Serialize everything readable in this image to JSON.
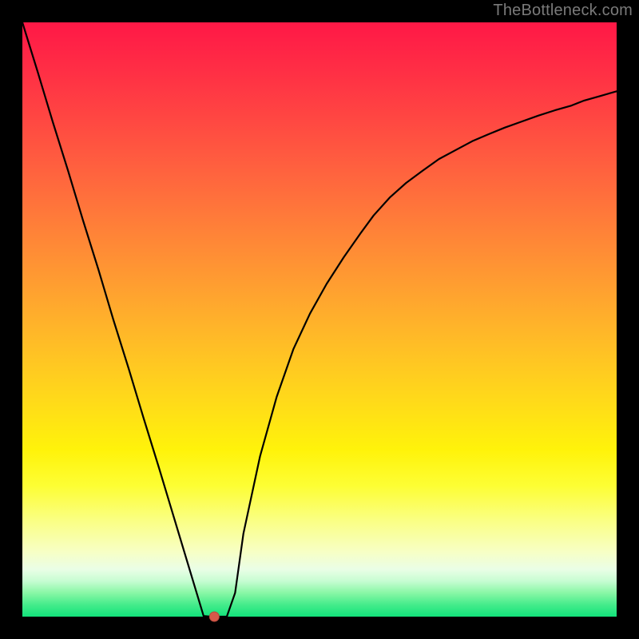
{
  "watermark": "TheBottleneck.com",
  "chart_data": {
    "type": "line",
    "title": "",
    "xlabel": "",
    "ylabel": "",
    "xlim": [
      0,
      100
    ],
    "ylim": [
      0,
      100
    ],
    "gradient_axis": "y",
    "gradient_stops": [
      {
        "pos": 0.0,
        "color": "#ff1846"
      },
      {
        "pos": 0.2,
        "color": "#ff5f3f"
      },
      {
        "pos": 0.45,
        "color": "#ffaa2d"
      },
      {
        "pos": 0.7,
        "color": "#fff30a"
      },
      {
        "pos": 0.86,
        "color": "#f9ffb0"
      },
      {
        "pos": 0.95,
        "color": "#8ff8aa"
      },
      {
        "pos": 1.0,
        "color": "#12e37b"
      }
    ],
    "series": [
      {
        "name": "curve",
        "x": [
          0.0,
          2.6,
          5.1,
          7.7,
          10.2,
          12.8,
          15.3,
          17.9,
          20.4,
          23.0,
          25.5,
          28.0,
          30.5,
          31.7,
          33.0,
          34.4,
          35.8,
          37.2,
          40.0,
          42.8,
          45.6,
          48.4,
          51.2,
          54.1,
          56.9,
          59.1,
          61.8,
          64.6,
          67.3,
          70.1,
          72.9,
          75.7,
          78.5,
          81.2,
          84.0,
          86.8,
          89.6,
          92.4,
          94.4,
          97.2,
          100.0
        ],
        "y": [
          100.0,
          91.6,
          83.3,
          75.0,
          66.7,
          58.4,
          50.0,
          41.7,
          33.4,
          25.0,
          16.7,
          8.4,
          0.1,
          0.0,
          0.0,
          0.0,
          4.0,
          14.0,
          27.0,
          37.0,
          45.0,
          51.0,
          56.0,
          60.5,
          64.5,
          67.5,
          70.5,
          73.0,
          75.0,
          77.0,
          78.5,
          80.0,
          81.2,
          82.3,
          83.3,
          84.3,
          85.2,
          86.0,
          86.8,
          87.6,
          88.4
        ]
      }
    ],
    "min_marker": {
      "x": 32.3,
      "y": 0.0
    }
  }
}
